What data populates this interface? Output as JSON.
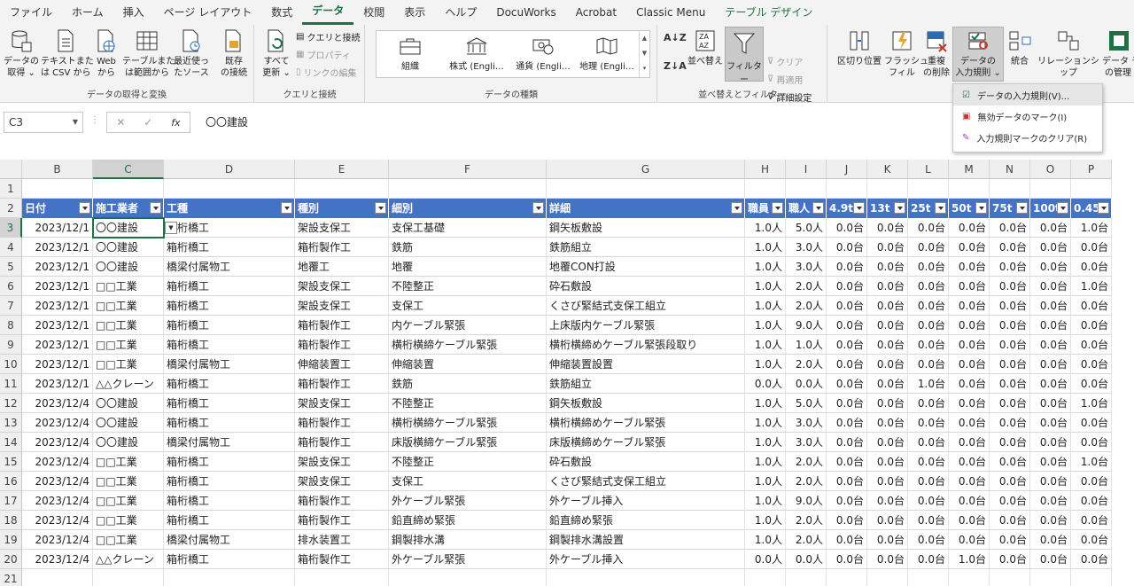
{
  "tabs": [
    "ファイル",
    "ホーム",
    "挿入",
    "ページ レイアウト",
    "数式",
    "データ",
    "校閲",
    "表示",
    "ヘルプ",
    "DocuWorks",
    "Acrobat",
    "Classic Menu",
    "テーブル デザイン"
  ],
  "active_tab": "データ",
  "ribbon": {
    "get_data": {
      "btn1": "データの\n取得 ⌄",
      "btn2": "テキストまた\nは CSV から",
      "btn3": "Web\nから",
      "btn4": "テーブルまた\nは範囲から",
      "btn5": "最近使っ\nたソース",
      "btn6": "既存\nの接続",
      "label": "データの取得と変換"
    },
    "queries": {
      "refresh": "すべて\n更新 ⌄",
      "q1": "クエリと接続",
      "q2": "プロパティ",
      "q3": "リンクの編集",
      "label": "クエリと接続"
    },
    "datatypes": {
      "items": [
        "組織",
        "株式 (Engli…",
        "通貨 (Engli…",
        "地理 (Engli…"
      ],
      "label": "データの種類"
    },
    "sort": {
      "sort": "並べ替え",
      "filter": "フィルター",
      "clear": "クリア",
      "reapply": "再適用",
      "advanced": "詳細設定",
      "label": "並べ替えとフィルター"
    },
    "tools": {
      "t1": "区切り位置",
      "t2": "フラッシュ\nフィル",
      "t3": "重複\nの削除",
      "t4": "データの\n入力規則 ⌄",
      "t5": "統合",
      "t6": "リレーションシップ",
      "t7": "データ モ\nの管理"
    }
  },
  "menu": {
    "items": [
      "データの入力規則(V)...",
      "無効データのマーク(I)",
      "入力規則マークのクリア(R)"
    ]
  },
  "formula": {
    "namebox": "C3",
    "value": "〇〇建設"
  },
  "columns": [
    "B",
    "C",
    "D",
    "E",
    "F",
    "G",
    "H",
    "I",
    "J",
    "K",
    "L",
    "M",
    "N",
    "O",
    "P"
  ],
  "header_row": [
    "日付",
    "施工業者",
    "工種",
    "種別",
    "細別",
    "詳細",
    "職員",
    "職人",
    "4.9t",
    "13t",
    "25t",
    "50t",
    "75t",
    "100t",
    "0.45"
  ],
  "rows": [
    [
      "2023/12/1",
      "〇〇建設",
      "箱桁橋工",
      "架設支保工",
      "支保工基礎",
      "鋼矢板敷設",
      "1.0人",
      "5.0人",
      "0.0台",
      "0.0台",
      "0.0台",
      "0.0台",
      "0.0台",
      "0.0台",
      "1.0台"
    ],
    [
      "2023/12/1",
      "〇〇建設",
      "箱桁橋工",
      "箱桁製作工",
      "鉄筋",
      "鉄筋組立",
      "1.0人",
      "3.0人",
      "0.0台",
      "0.0台",
      "0.0台",
      "0.0台",
      "0.0台",
      "0.0台",
      "0.0台"
    ],
    [
      "2023/12/1",
      "〇〇建設",
      "橋梁付属物工",
      "地覆工",
      "地覆",
      "地覆CON打設",
      "1.0人",
      "3.0人",
      "0.0台",
      "0.0台",
      "0.0台",
      "0.0台",
      "0.0台",
      "0.0台",
      "0.0台"
    ],
    [
      "2023/12/1",
      "□□工業",
      "箱桁橋工",
      "架設支保工",
      "不陸整正",
      "砕石敷設",
      "1.0人",
      "2.0人",
      "0.0台",
      "0.0台",
      "0.0台",
      "0.0台",
      "0.0台",
      "0.0台",
      "1.0台"
    ],
    [
      "2023/12/1",
      "□□工業",
      "箱桁橋工",
      "架設支保工",
      "支保工",
      "くさび緊結式支保工組立",
      "1.0人",
      "2.0人",
      "0.0台",
      "0.0台",
      "0.0台",
      "0.0台",
      "0.0台",
      "0.0台",
      "0.0台"
    ],
    [
      "2023/12/1",
      "□□工業",
      "箱桁橋工",
      "箱桁製作工",
      "内ケーブル緊張",
      "上床版内ケーブル緊張",
      "1.0人",
      "9.0人",
      "0.0台",
      "0.0台",
      "0.0台",
      "0.0台",
      "0.0台",
      "0.0台",
      "0.0台"
    ],
    [
      "2023/12/1",
      "□□工業",
      "箱桁橋工",
      "箱桁製作工",
      "横桁横締ケーブル緊張",
      "横桁横締めケーブル緊張段取り",
      "1.0人",
      "1.0人",
      "0.0台",
      "0.0台",
      "0.0台",
      "0.0台",
      "0.0台",
      "0.0台",
      "0.0台"
    ],
    [
      "2023/12/1",
      "□□工業",
      "橋梁付属物工",
      "伸縮装置工",
      "伸縮装置",
      "伸縮装置設置",
      "1.0人",
      "2.0人",
      "0.0台",
      "0.0台",
      "0.0台",
      "0.0台",
      "0.0台",
      "0.0台",
      "0.0台"
    ],
    [
      "2023/12/1",
      "△△クレーン",
      "箱桁橋工",
      "箱桁製作工",
      "鉄筋",
      "鉄筋組立",
      "0.0人",
      "0.0人",
      "0.0台",
      "0.0台",
      "1.0台",
      "0.0台",
      "0.0台",
      "0.0台",
      "0.0台"
    ],
    [
      "2023/12/4",
      "〇〇建設",
      "箱桁橋工",
      "架設支保工",
      "不陸整正",
      "鋼矢板敷設",
      "1.0人",
      "5.0人",
      "0.0台",
      "0.0台",
      "0.0台",
      "0.0台",
      "0.0台",
      "0.0台",
      "1.0台"
    ],
    [
      "2023/12/4",
      "〇〇建設",
      "箱桁橋工",
      "箱桁製作工",
      "横桁横締ケーブル緊張",
      "横桁横締めケーブル緊張",
      "1.0人",
      "3.0人",
      "0.0台",
      "0.0台",
      "0.0台",
      "0.0台",
      "0.0台",
      "0.0台",
      "0.0台"
    ],
    [
      "2023/12/4",
      "〇〇建設",
      "橋梁付属物工",
      "箱桁製作工",
      "床版横締ケーブル緊張",
      "床版横締めケーブル緊張",
      "1.0人",
      "3.0人",
      "0.0台",
      "0.0台",
      "0.0台",
      "0.0台",
      "0.0台",
      "0.0台",
      "0.0台"
    ],
    [
      "2023/12/4",
      "□□工業",
      "箱桁橋工",
      "架設支保工",
      "不陸整正",
      "砕石敷設",
      "1.0人",
      "2.0人",
      "0.0台",
      "0.0台",
      "0.0台",
      "0.0台",
      "0.0台",
      "0.0台",
      "1.0台"
    ],
    [
      "2023/12/4",
      "□□工業",
      "箱桁橋工",
      "架設支保工",
      "支保工",
      "くさび緊結式支保工組立",
      "1.0人",
      "2.0人",
      "0.0台",
      "0.0台",
      "0.0台",
      "0.0台",
      "0.0台",
      "0.0台",
      "0.0台"
    ],
    [
      "2023/12/4",
      "□□工業",
      "箱桁橋工",
      "箱桁製作工",
      "外ケーブル緊張",
      "外ケーブル挿入",
      "1.0人",
      "9.0人",
      "0.0台",
      "0.0台",
      "0.0台",
      "0.0台",
      "0.0台",
      "0.0台",
      "0.0台"
    ],
    [
      "2023/12/4",
      "□□工業",
      "箱桁橋工",
      "箱桁製作工",
      "鉛直締め緊張",
      "鉛直締め緊張",
      "1.0人",
      "2.0人",
      "0.0台",
      "0.0台",
      "0.0台",
      "0.0台",
      "0.0台",
      "0.0台",
      "0.0台"
    ],
    [
      "2023/12/4",
      "□□工業",
      "橋梁付属物工",
      "排水装置工",
      "鋼製排水溝",
      "鋼製排水溝設置",
      "1.0人",
      "2.0人",
      "0.0台",
      "0.0台",
      "0.0台",
      "0.0台",
      "0.0台",
      "0.0台",
      "0.0台"
    ],
    [
      "2023/12/4",
      "△△クレーン",
      "箱桁橋工",
      "箱桁製作工",
      "外ケーブル緊張",
      "外ケーブル挿入",
      "0.0人",
      "0.0人",
      "0.0台",
      "0.0台",
      "0.0台",
      "1.0台",
      "0.0台",
      "0.0台",
      "0.0台"
    ]
  ],
  "row_numbers": [
    "1",
    "2",
    "3",
    "4",
    "5",
    "6",
    "7",
    "8",
    "9",
    "10",
    "11",
    "12",
    "13",
    "14",
    "15",
    "16",
    "17",
    "18",
    "19",
    "20",
    "21"
  ],
  "colors": {
    "accent": "#1e7145",
    "table_header": "#4472c4"
  }
}
